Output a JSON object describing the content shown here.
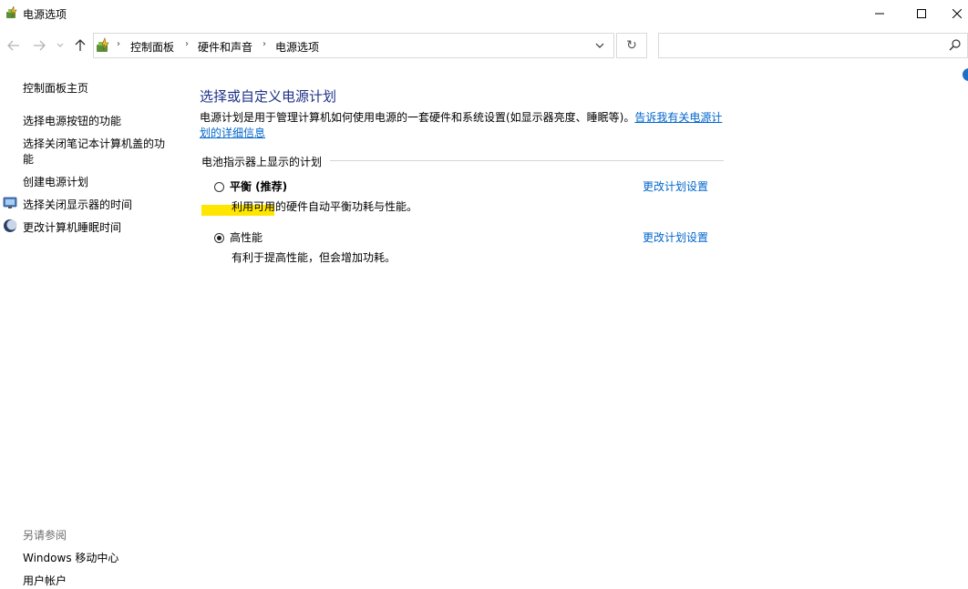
{
  "window": {
    "title": "电源选项",
    "minimize_glyph": "—",
    "maximize_glyph": "☐",
    "close_glyph": "✕"
  },
  "address": {
    "crumbs": [
      "控制面板",
      "硬件和声音",
      "电源选项"
    ],
    "search_placeholder": "",
    "refresh_glyph": "↻",
    "dropdown_glyph": "﹀"
  },
  "sidebar": {
    "home": "控制面板主页",
    "items": [
      {
        "label": "选择电源按钮的功能"
      },
      {
        "label": "选择关闭笔记本计算机盖的功",
        "label2": "能"
      },
      {
        "label": "创建电源计划"
      },
      {
        "label": "选择关闭显示器的时间",
        "icon": "monitor-icon"
      },
      {
        "label": "更改计算机睡眠时间",
        "icon": "moon-icon"
      }
    ],
    "see_also": "另请参阅",
    "see_also_items": [
      "Windows 移动中心",
      "用户帐户"
    ]
  },
  "main": {
    "title": "选择或自定义电源计划",
    "description": "电源计划是用于管理计算机如何使用电源的一套硬件和系统设置(如显示器亮度、睡眠等)。",
    "description_link_1": "告诉我有关电源计",
    "description_link_2": "划的详细信息",
    "group_label": "电池指示器上显示的计划",
    "plans": [
      {
        "name": "平衡 (推荐)",
        "description": "利用可用的硬件自动平衡功耗与性能。",
        "selected": false,
        "link": "更改计划设置"
      },
      {
        "name": "高性能",
        "description": "有利于提高性能，但会增加功耗。",
        "selected": true,
        "link": "更改计划设置"
      }
    ]
  },
  "colors": {
    "title_blue": "#1e3287",
    "link_blue": "#0066cc",
    "highlight_yellow": "#ffe600"
  }
}
